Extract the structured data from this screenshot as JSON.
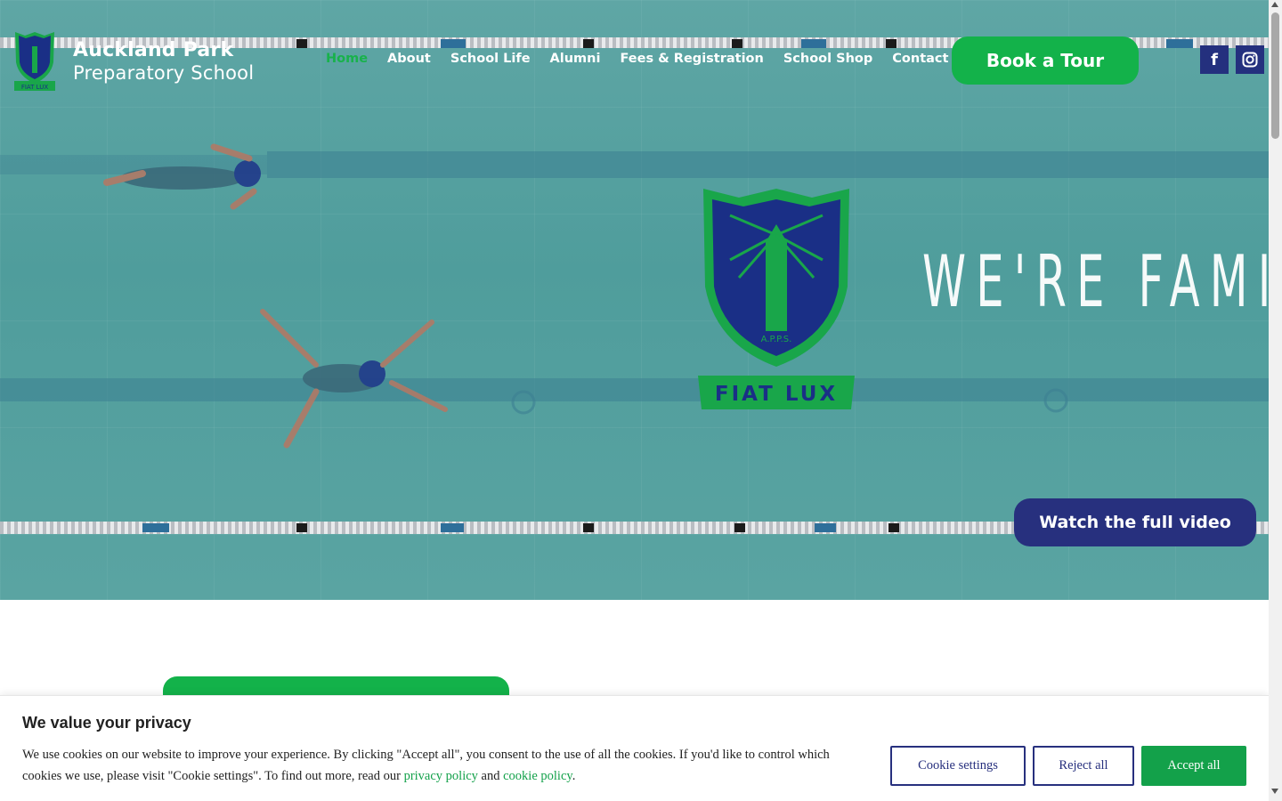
{
  "header": {
    "brand_line1": "Auckland Park",
    "brand_line2": "Preparatory School",
    "crest_banner": "FIAT LUX",
    "nav": [
      {
        "label": "Home",
        "active": true
      },
      {
        "label": "About"
      },
      {
        "label": "School Life"
      },
      {
        "label": "Alumni"
      },
      {
        "label": "Fees & Registration"
      },
      {
        "label": "School Shop"
      },
      {
        "label": "Contact Us"
      }
    ],
    "tour_button": "Book a Tour",
    "social": [
      {
        "name": "facebook-icon",
        "glyph": "f"
      },
      {
        "name": "instagram-icon"
      }
    ]
  },
  "hero": {
    "tagline": "WE'RE FAMILY",
    "crest_initials": "A.P.P.S.",
    "crest_banner": "FIAT LUX",
    "video_button": "Watch the full video"
  },
  "cookie": {
    "title": "We value your privacy",
    "text_part1": "We use cookies on our website to improve your experience. By clicking \"Accept all\", you consent to the use of all the cookies. If you'd like to control which cookies we use, please visit \"Cookie settings\". To find out more, read our ",
    "privacy_link": "privacy policy",
    "text_and": " and ",
    "cookie_link": "cookie policy",
    "text_end": ".",
    "settings_button": "Cookie settings",
    "reject_button": "Reject all",
    "accept_button": "Accept all"
  },
  "colors": {
    "brand_green": "#13b24a",
    "brand_navy": "#27307e",
    "pool": "#54a19f"
  }
}
